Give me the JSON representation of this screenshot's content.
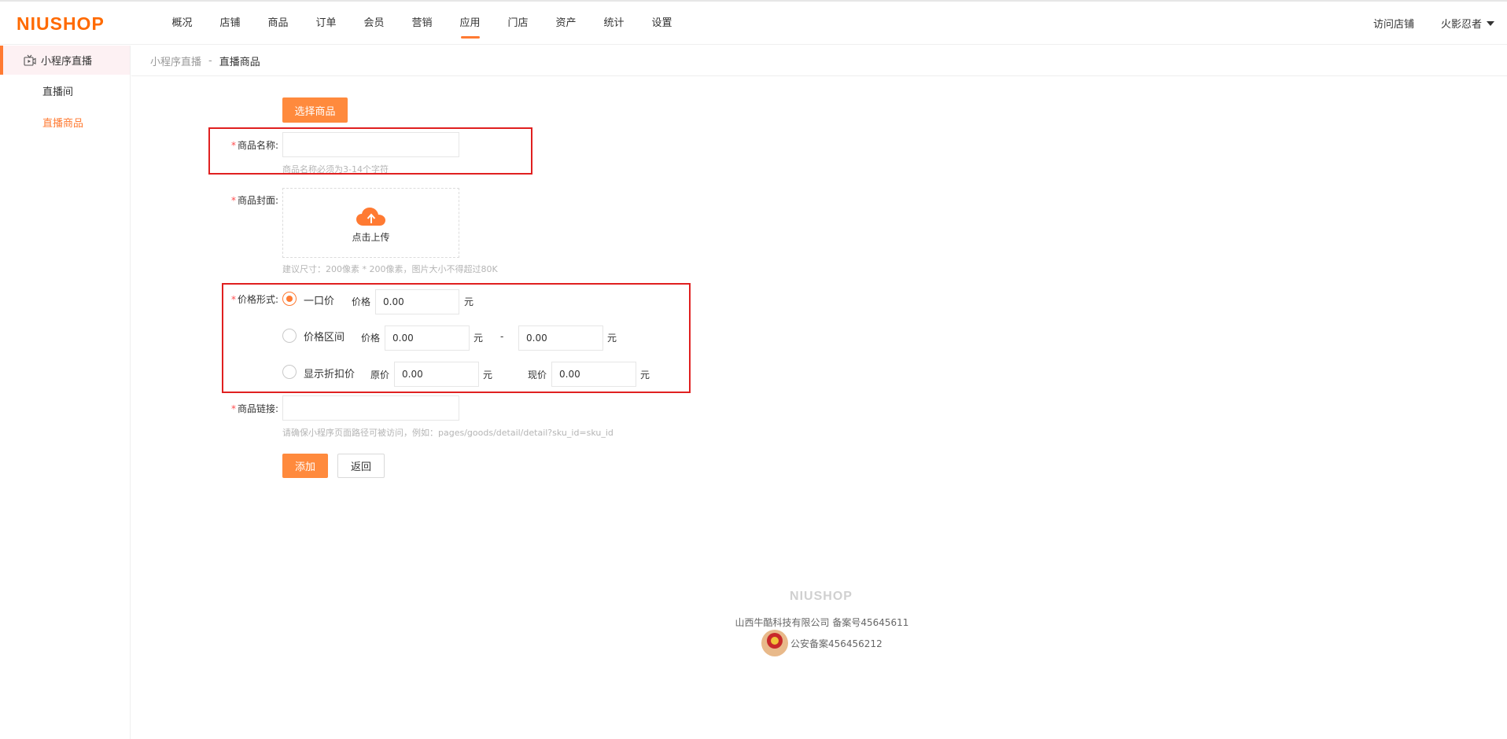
{
  "header": {
    "logo": "NIUSHOP",
    "nav": [
      "概况",
      "店铺",
      "商品",
      "订单",
      "会员",
      "营销",
      "应用",
      "门店",
      "资产",
      "统计",
      "设置"
    ],
    "active_nav": "应用",
    "visit_store": "访问店铺",
    "username": "火影忍者"
  },
  "sidebar": {
    "group_label": "小程序直播",
    "group_icon": "live-video-icon",
    "items": [
      {
        "label": "直播间",
        "active": false
      },
      {
        "label": "直播商品",
        "active": true
      }
    ]
  },
  "breadcrumb": {
    "parent": "小程序直播",
    "separator": "-",
    "current": "直播商品"
  },
  "form": {
    "select_goods_button": "选择商品",
    "name_label": "商品名称:",
    "name_value": "",
    "name_hint": "商品名称必须为3-14个字符",
    "cover_label": "商品封面:",
    "upload_text": "点击上传",
    "upload_icon": "cloud-upload-icon",
    "cover_hint": "建议尺寸：200像素 * 200像素，图片大小不得超过80K",
    "price_label": "价格形式:",
    "price_options": [
      {
        "label": "一口价",
        "checked": true
      },
      {
        "label": "价格区间",
        "checked": false
      },
      {
        "label": "显示折扣价",
        "checked": false
      }
    ],
    "price_text": "价格",
    "fixed_price": "0.00",
    "range_from": "0.00",
    "range_to": "0.00",
    "range_dash": "-",
    "yuan": "元",
    "original_price_text": "原价",
    "original_price": "0.00",
    "current_price_text": "现价",
    "current_price": "0.00",
    "link_label": "商品链接:",
    "link_value": "",
    "link_hint": "请确保小程序页面路径可被访问，例如：pages/goods/detail/detail?sku_id=sku_id",
    "add_button": "添加",
    "back_button": "返回"
  },
  "footer": {
    "logo": "NIUSHOP",
    "company": "山西牛酷科技有限公司  备案号45645611",
    "police": "公安备案456456212"
  },
  "colors": {
    "accent": "#ff7a32",
    "button": "#ff8a3d",
    "highlight_box": "#e02020",
    "required_star": "#ff4d4f"
  }
}
